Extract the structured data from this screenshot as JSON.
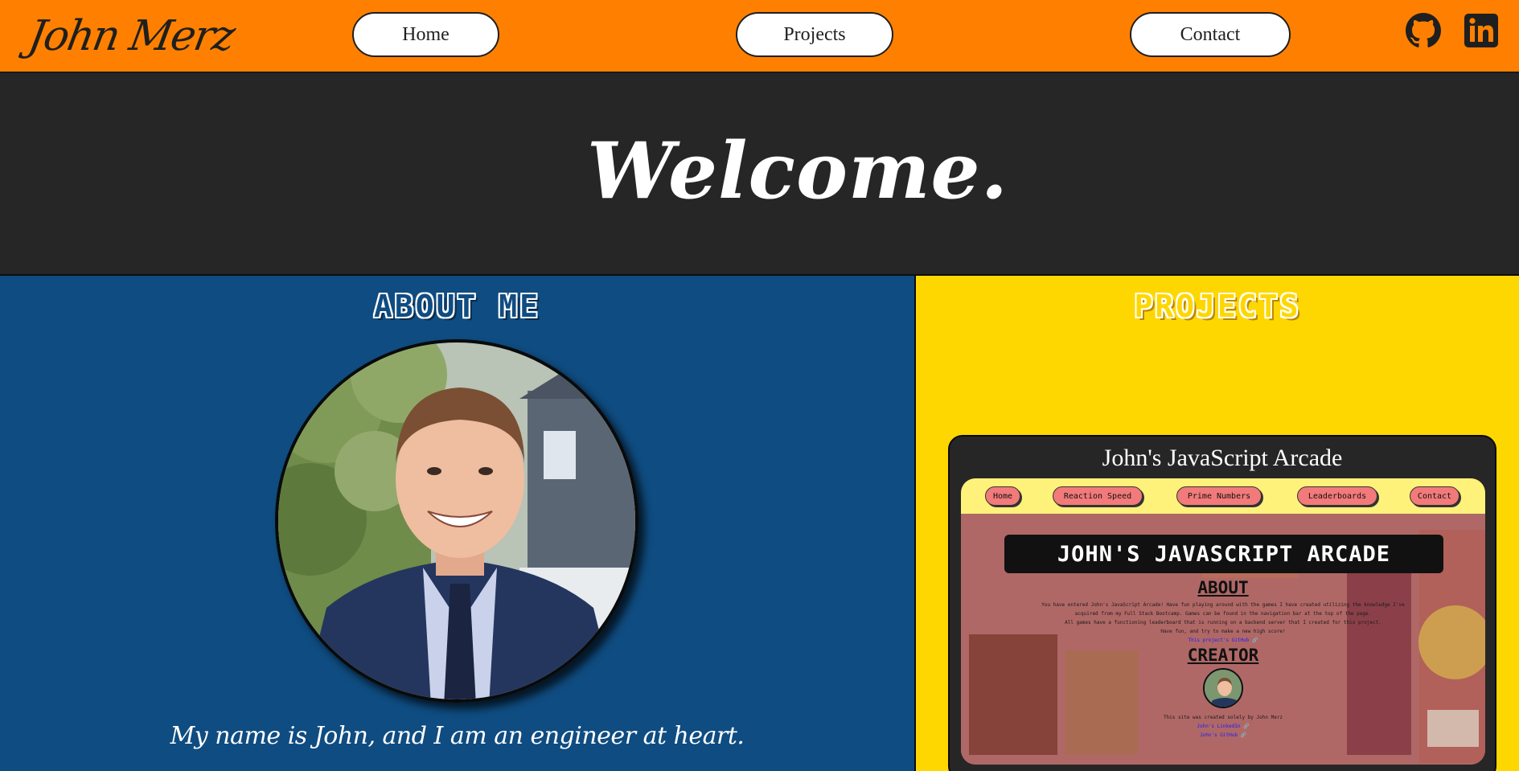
{
  "nav": {
    "brand": "John Merz",
    "home": "Home",
    "projects": "Projects",
    "contact": "Contact",
    "icons": [
      "github-icon",
      "linkedin-icon"
    ]
  },
  "welcome": {
    "heading": "Welcome."
  },
  "about": {
    "heading": "ABOUT ME",
    "tagline": "My name is John, and I am an engineer at heart."
  },
  "projects": {
    "heading": "PROJECTS",
    "card": {
      "title": "John's JavaScript Arcade",
      "preview": {
        "nav": [
          "Home",
          "Reaction Speed",
          "Prime Numbers",
          "Leaderboards",
          "Contact"
        ],
        "banner": "JOHN'S JAVASCRIPT ARCADE",
        "about_heading": "ABOUT",
        "about_lines": [
          "You have entered John's JavaScript Arcade! Have fun playing around with the games I have created utilizing the knowledge I've",
          "acquired from my Full Stack Bootcamp. Games can be found in the navigation bar at the top of the page.",
          "All games have a functioning leaderboard that is running on a backend server that I created for this project.",
          "Have fun, and try to make a new high score!"
        ],
        "about_link": "This project's GitHub 🔗",
        "creator_heading": "CREATOR",
        "creator_line": "This site was created solely by John Merz",
        "creator_links": [
          "John's LinkedIn 🔗",
          "John's GitHub 🔗"
        ]
      }
    }
  },
  "colors": {
    "navbar": "#ff8000",
    "welcome_bg": "#262626",
    "about_bg": "#0f4c81",
    "projects_bg": "#ffd700"
  }
}
